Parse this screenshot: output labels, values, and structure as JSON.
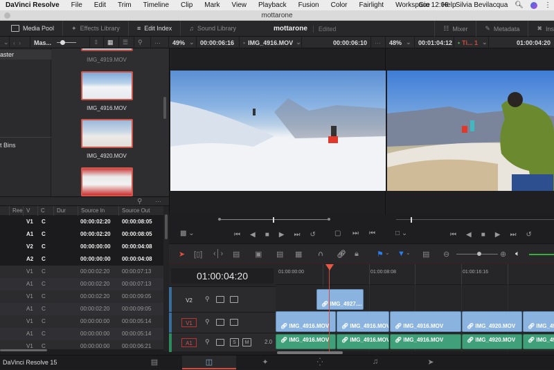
{
  "menubar": {
    "app": "DaVinci Resolve",
    "items": [
      "File",
      "Edit",
      "Trim",
      "Timeline",
      "Clip",
      "Mark",
      "View",
      "Playback",
      "Fusion",
      "Color",
      "Fairlight",
      "Workspace",
      "Help"
    ],
    "clock": "Gio 12:08",
    "user": "Silvia Bevilacqua"
  },
  "window": {
    "title": "mottarone"
  },
  "toolbar": {
    "media_pool": "Media Pool",
    "effects_library": "Effects Library",
    "edit_index": "Edit Index",
    "sound_library": "Sound Library",
    "project_name": "mottarone",
    "project_status": "Edited",
    "mixer": "Mixer",
    "metadata": "Metadata",
    "inspector": "Ins"
  },
  "subbar": {
    "bin_name": "Mas...",
    "source_zoom": "49%",
    "source_duration": "00:00:06:16",
    "source_clip": "IMG_4916.MOV",
    "source_timecode": "00:00:06:10",
    "timeline_zoom": "48%",
    "timeline_duration": "00:01:04:12",
    "timeline_name": "Ti... 1",
    "timeline_timecode": "01:00:04:20"
  },
  "bins": {
    "master": "aster",
    "smart_bins": "t Bins"
  },
  "media_pool": {
    "clips": [
      {
        "name": "IMG_4919.MOV",
        "dim": true
      },
      {
        "name": "IMG_4916.MOV",
        "dim": false
      },
      {
        "name": "IMG_4920.MOV",
        "dim": false
      },
      {
        "name": "",
        "dim": false
      }
    ]
  },
  "edit_index": {
    "columns": [
      "Ree",
      "V",
      "C",
      "Dur",
      "Source In",
      "Source Out"
    ],
    "rows": [
      {
        "v": "V1",
        "c": "C",
        "in": "00:00:02:20",
        "out": "00:00:08:05",
        "sel": true
      },
      {
        "v": "A1",
        "c": "C",
        "in": "00:00:02:20",
        "out": "00:00:08:05",
        "sel": true
      },
      {
        "v": "V2",
        "c": "C",
        "in": "00:00:00:00",
        "out": "00:00:04:08",
        "sel": true
      },
      {
        "v": "A2",
        "c": "C",
        "in": "00:00:00:00",
        "out": "00:00:04:08",
        "sel": true
      },
      {
        "v": "V1",
        "c": "C",
        "in": "00:00:02:20",
        "out": "00:00:07:13",
        "sel": false
      },
      {
        "v": "A1",
        "c": "C",
        "in": "00:00:02:20",
        "out": "00:00:07:13",
        "sel": false
      },
      {
        "v": "V1",
        "c": "C",
        "in": "00:00:02:20",
        "out": "00:00:09:05",
        "sel": false
      },
      {
        "v": "A1",
        "c": "C",
        "in": "00:00:02:20",
        "out": "00:00:09:05",
        "sel": false
      },
      {
        "v": "V1",
        "c": "C",
        "in": "00:00:00:00",
        "out": "00:00:05:14",
        "sel": false
      },
      {
        "v": "A1",
        "c": "C",
        "in": "00:00:00:00",
        "out": "00:00:05:14",
        "sel": false
      },
      {
        "v": "V1",
        "c": "C",
        "in": "00:00:00:00",
        "out": "00:00:06:21",
        "sel": false
      }
    ]
  },
  "timeline": {
    "timecode": "01:00:04:20",
    "ruler": [
      "01:00:00:00",
      "01:00:08:08",
      "01:00:16:16"
    ],
    "tracks": {
      "v2": {
        "label": "V2"
      },
      "v1": {
        "label": "V1"
      },
      "a1": {
        "label": "A1",
        "solo": "S",
        "mute": "M",
        "channels": "2.0"
      }
    },
    "clips_v2": [
      {
        "name": "IMG_4927...."
      }
    ],
    "clips_v1": [
      {
        "name": "IMG_4916.MOV"
      },
      {
        "name": "IMG_4916.MOV"
      },
      {
        "name": "IMG_4916.MOV"
      },
      {
        "name": "IMG_4920.MOV"
      },
      {
        "name": "IMG_49"
      }
    ],
    "clips_a1": [
      {
        "name": "IMG_4916.MOV"
      },
      {
        "name": "IMG_4916.MOV"
      },
      {
        "name": "IMG_4916.MOV"
      },
      {
        "name": "IMG_4920.MOV"
      },
      {
        "name": "IMG_49"
      }
    ]
  },
  "pagebar": {
    "app_label": "DaVinci Resolve 15",
    "pages": [
      "media",
      "edit",
      "fusion",
      "color",
      "fairlight",
      "deliver"
    ],
    "active": "edit"
  },
  "colors": {
    "accent_red": "#d04c3c",
    "video_clip": "#8ab4df",
    "audio_clip": "#40a07a"
  }
}
